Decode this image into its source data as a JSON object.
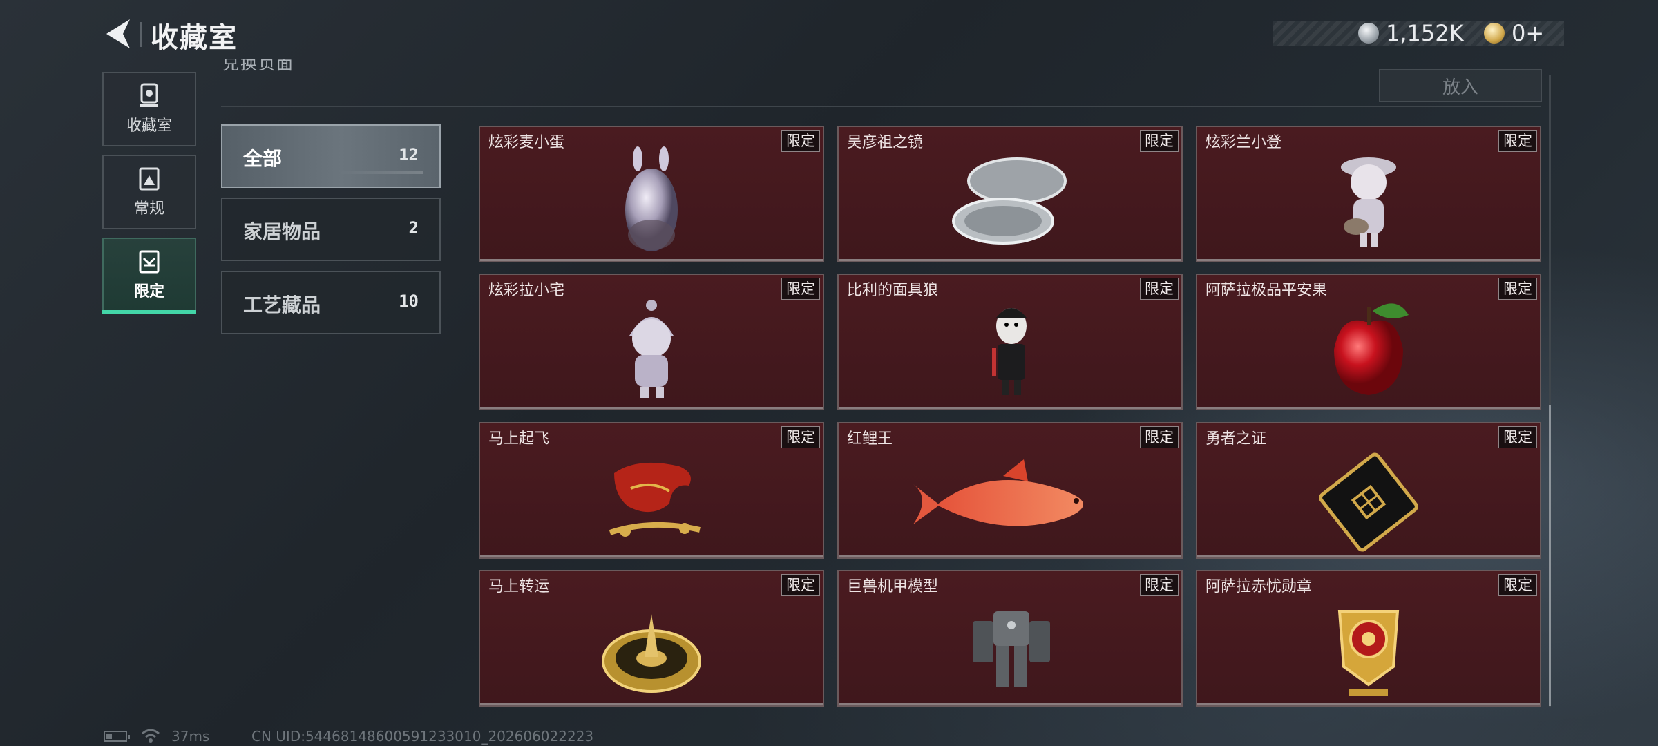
{
  "header": {
    "title": "收藏室",
    "currency_silver": "1,152K",
    "currency_gold": "0+"
  },
  "rail": [
    {
      "label": "收藏室",
      "icon": "trophy-icon"
    },
    {
      "label": "常规",
      "icon": "photo-icon"
    },
    {
      "label": "限定",
      "icon": "limited-icon",
      "active": true
    }
  ],
  "panel": {
    "cut_text": "兑换页面",
    "put_label": "放入"
  },
  "categories": [
    {
      "name": "全部",
      "count": "12",
      "selected": true
    },
    {
      "name": "家居物品",
      "count": "2"
    },
    {
      "name": "工艺藏品",
      "count": "10"
    }
  ],
  "items": [
    {
      "name": "炫彩麦小蛋",
      "tag": "限定",
      "icon": "rabbit-egg-figure"
    },
    {
      "name": "吴彦祖之镜",
      "tag": "限定",
      "icon": "compact-mirror"
    },
    {
      "name": "炫彩兰小登",
      "tag": "限定",
      "icon": "guitar-doll-figure"
    },
    {
      "name": "炫彩拉小宅",
      "tag": "限定",
      "icon": "hooded-doll-figure"
    },
    {
      "name": "比利的面具狼",
      "tag": "限定",
      "icon": "puppet-figure"
    },
    {
      "name": "阿萨拉极品平安果",
      "tag": "限定",
      "icon": "red-apple"
    },
    {
      "name": "马上起飞",
      "tag": "限定",
      "icon": "rocking-horse"
    },
    {
      "name": "红鲤王",
      "tag": "限定",
      "icon": "red-carp"
    },
    {
      "name": "勇者之证",
      "tag": "限定",
      "icon": "black-card"
    },
    {
      "name": "马上转运",
      "tag": "限定",
      "icon": "gold-turntable"
    },
    {
      "name": "巨兽机甲模型",
      "tag": "限定",
      "icon": "mech-model"
    },
    {
      "name": "阿萨拉赤忧勋章",
      "tag": "限定",
      "icon": "gold-medal"
    }
  ],
  "footer": {
    "ping": "37ms",
    "uid": "CN UID:5446814860059123301​0_202606022223"
  },
  "colors": {
    "accent": "#43d6a8",
    "card_bg": "#4a1b20"
  }
}
